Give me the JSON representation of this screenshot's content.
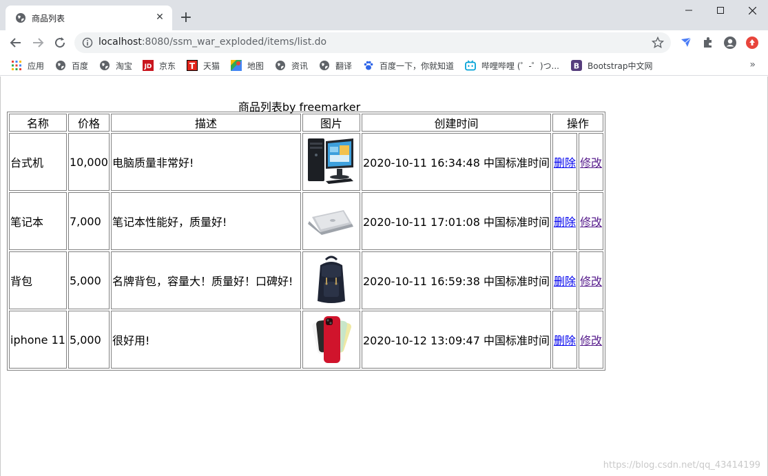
{
  "browser": {
    "tab_title": "商品列表",
    "url_host": "localhost",
    "url_rest": ":8080/ssm_war_exploded/items/list.do",
    "bookmarks": [
      {
        "label": "应用",
        "icon": "apps-grid-icon"
      },
      {
        "label": "百度",
        "icon": "globe-icon"
      },
      {
        "label": "淘宝",
        "icon": "globe-icon"
      },
      {
        "label": "京东",
        "icon": "jd-logo-icon"
      },
      {
        "label": "天猫",
        "icon": "tmall-logo-icon"
      },
      {
        "label": "地图",
        "icon": "maps-icon"
      },
      {
        "label": "资讯",
        "icon": "globe-icon"
      },
      {
        "label": "翻译",
        "icon": "globe-icon"
      },
      {
        "label": "百度一下，你就知道",
        "icon": "baidu-paw-icon"
      },
      {
        "label": "哔哩哔哩 (゜-゜)つ...",
        "icon": "bilibili-icon"
      },
      {
        "label": "Bootstrap中文网",
        "icon": "bootstrap-logo-icon"
      }
    ],
    "more_label": "»"
  },
  "page": {
    "caption": "商品列表by freemarker",
    "headers": {
      "name": "名称",
      "price": "价格",
      "desc": "描述",
      "pic": "图片",
      "created": "创建时间",
      "ops": "操作"
    },
    "rows": [
      {
        "name": "台式机",
        "price": "10,000",
        "desc": "电脑质量非常好!",
        "pic": "desktop-computer-image",
        "created": "2020-10-11 16:34:48 中国标准时间",
        "delete": "删除",
        "edit": "修改"
      },
      {
        "name": "笔记本",
        "price": "7,000",
        "desc": "笔记本性能好，质量好!",
        "pic": "laptop-image",
        "created": "2020-10-11 17:01:08 中国标准时间",
        "delete": "删除",
        "edit": "修改"
      },
      {
        "name": "背包",
        "price": "5,000",
        "desc": "名牌背包，容量大！质量好！口碑好!",
        "pic": "backpack-image",
        "created": "2020-10-11 16:59:38 中国标准时间",
        "delete": "删除",
        "edit": "修改"
      },
      {
        "name": "iphone 11",
        "price": "5,000",
        "desc": "很好用!",
        "pic": "iphone-image",
        "created": "2020-10-12 13:09:47 中国标准时间",
        "delete": "删除",
        "edit": "修改"
      }
    ]
  },
  "watermark": "https://blog.csdn.net/qq_43414199"
}
